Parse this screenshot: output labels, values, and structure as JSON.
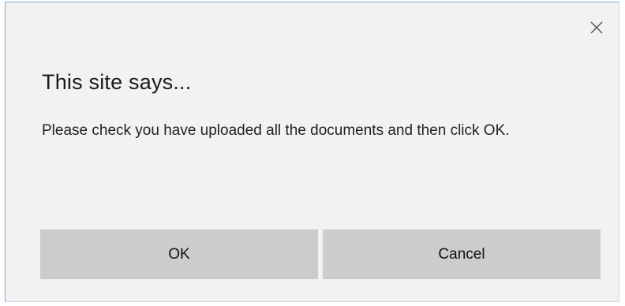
{
  "dialog": {
    "title": "This site says...",
    "message": "Please check you have uploaded all the documents and then click OK.",
    "close_icon": "close-icon",
    "buttons": {
      "ok_label": "OK",
      "cancel_label": "Cancel"
    }
  },
  "colors": {
    "dialog_background": "#f2f2f2",
    "button_background": "#cccccc",
    "accent_border": "#7aa6d9"
  }
}
